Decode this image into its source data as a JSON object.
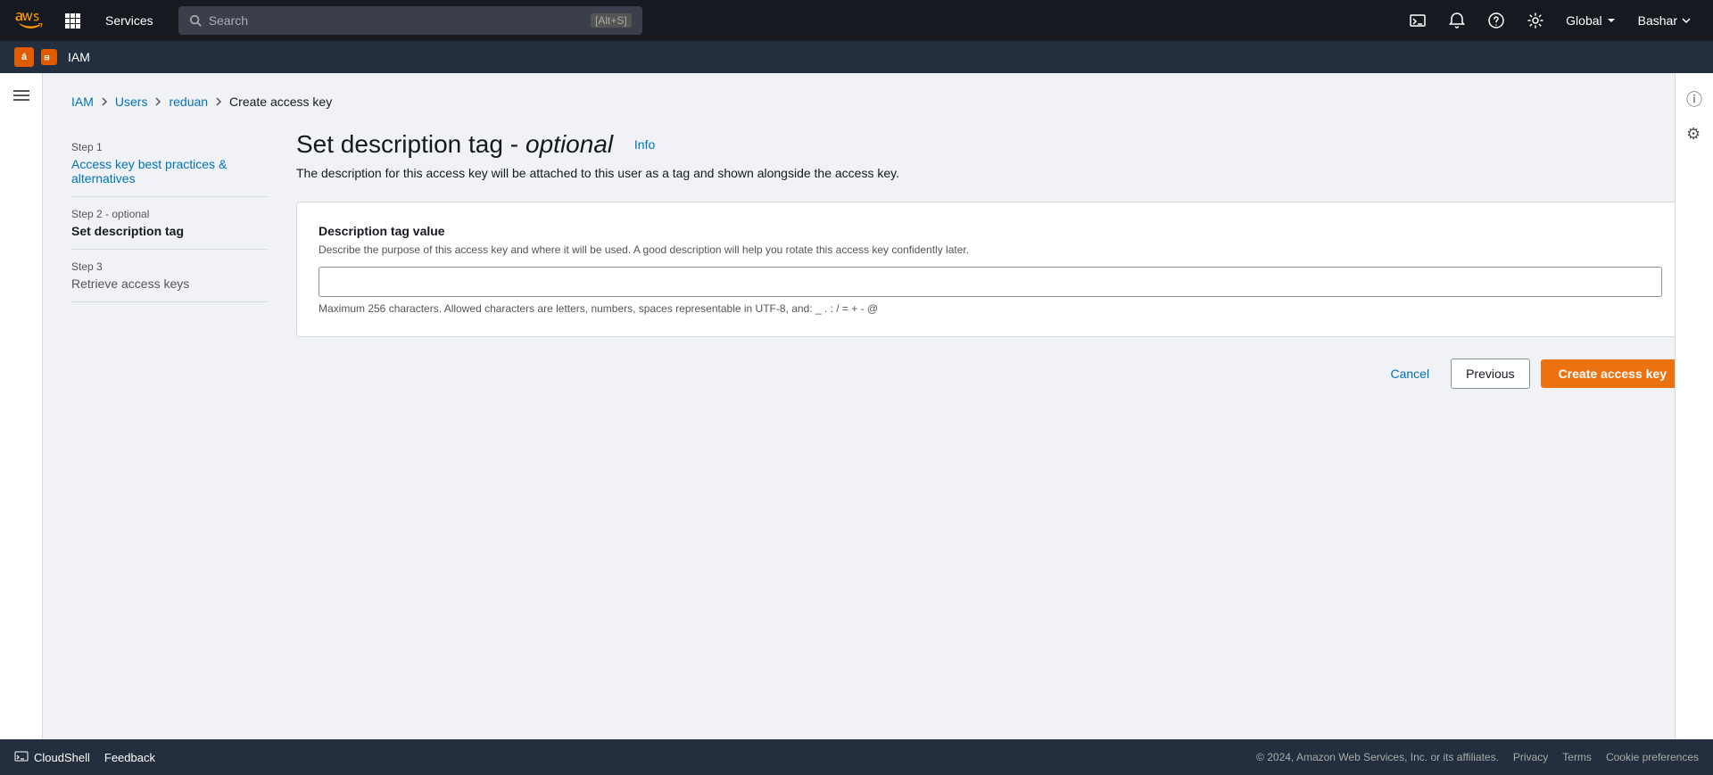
{
  "topnav": {
    "services_label": "Services",
    "search_placeholder": "Search",
    "search_shortcut": "[Alt+S]",
    "region_label": "Global",
    "user_label": "Bashar"
  },
  "servicebar": {
    "service_name": "IAM",
    "icon_text": "ⓘ"
  },
  "breadcrumb": {
    "iam": "IAM",
    "users": "Users",
    "reduan": "reduan",
    "current": "Create access key"
  },
  "steps": [
    {
      "label": "Step 1",
      "optional": false,
      "name": "Access key best practices & alternatives",
      "state": "link"
    },
    {
      "label": "Step 2 - optional",
      "optional": true,
      "name": "Set description tag",
      "state": "current"
    },
    {
      "label": "Step 3",
      "optional": false,
      "name": "Retrieve access keys",
      "state": "inactive"
    }
  ],
  "form": {
    "page_title_1": "Set description tag - ",
    "page_title_italic": "optional",
    "info_link": "Info",
    "subtitle": "The description for this access key will be attached to this user as a tag and shown alongside the access key.",
    "card": {
      "field_label": "Description tag value",
      "field_hint": "Describe the purpose of this access key and where it will be used. A good description will help you rotate this access key confidently later.",
      "input_value": "",
      "char_limit_note": "Maximum 256 characters. Allowed characters are letters, numbers, spaces representable in UTF-8, and: _ . : / = + - @"
    }
  },
  "actions": {
    "cancel_label": "Cancel",
    "previous_label": "Previous",
    "create_label": "Create access key"
  },
  "footer": {
    "cloudshell_label": "CloudShell",
    "feedback_label": "Feedback",
    "copyright": "© 2024, Amazon Web Services, Inc. or its affiliates.",
    "links": [
      "Privacy",
      "Terms",
      "Cookie preferences"
    ]
  }
}
